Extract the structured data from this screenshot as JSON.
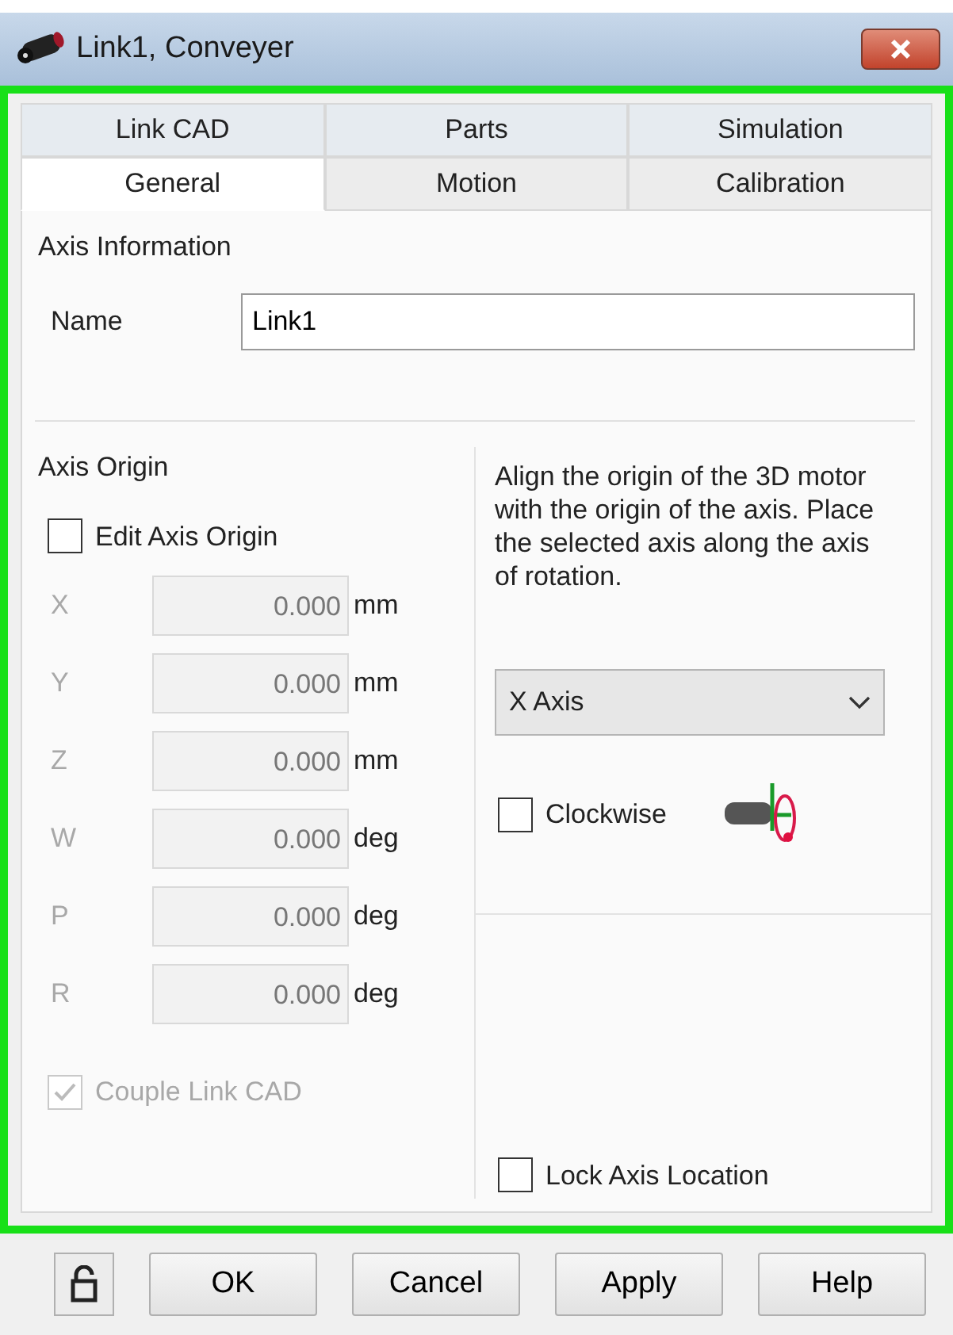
{
  "window": {
    "title": "Link1, Conveyer"
  },
  "tab_rows": [
    [
      {
        "label": "Link CAD",
        "selected": false
      },
      {
        "label": "Parts",
        "selected": false
      },
      {
        "label": "Simulation",
        "selected": false
      }
    ],
    [
      {
        "label": "General",
        "selected": true
      },
      {
        "label": "Motion",
        "selected": false
      },
      {
        "label": "Calibration",
        "selected": false
      }
    ]
  ],
  "axis_information": {
    "title": "Axis Information",
    "name_label": "Name",
    "name_value": "Link1"
  },
  "axis_origin": {
    "title": "Axis Origin",
    "edit_axis_origin": {
      "label": "Edit Axis Origin",
      "checked": false
    },
    "coordinates": [
      {
        "label": "X",
        "value": "0.000",
        "unit": "mm",
        "disabled": true
      },
      {
        "label": "Y",
        "value": "0.000",
        "unit": "mm",
        "disabled": true
      },
      {
        "label": "Z",
        "value": "0.000",
        "unit": "mm",
        "disabled": true
      },
      {
        "label": "W",
        "value": "0.000",
        "unit": "deg",
        "disabled": true
      },
      {
        "label": "P",
        "value": "0.000",
        "unit": "deg",
        "disabled": true
      },
      {
        "label": "R",
        "value": "0.000",
        "unit": "deg",
        "disabled": true
      }
    ],
    "couple_link_cad": {
      "label": "Couple Link CAD",
      "checked": true,
      "disabled": true
    }
  },
  "alignment": {
    "description": "Align the origin of the 3D motor with the origin of the axis.  Place the selected axis along the axis of rotation.",
    "axis_select": {
      "value": "X Axis"
    },
    "clockwise": {
      "label": "Clockwise",
      "checked": false
    },
    "lock_axis_location": {
      "label": "Lock Axis Location",
      "checked": false
    }
  },
  "buttons": [
    "OK",
    "Cancel",
    "Apply",
    "Help"
  ]
}
